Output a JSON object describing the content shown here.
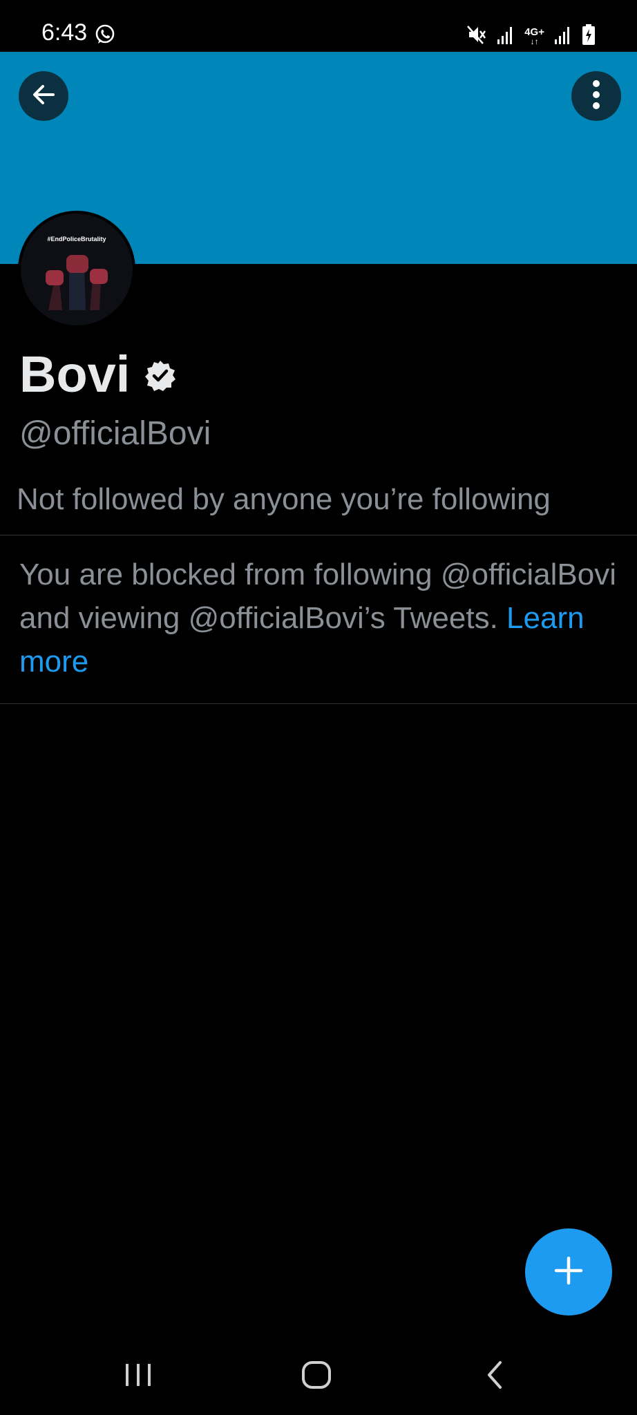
{
  "status_bar": {
    "time": "6:43",
    "network_label": "4G+",
    "icons": [
      "whatsapp-icon",
      "mute-icon",
      "signal-icon",
      "signal-icon",
      "battery-charging-icon"
    ]
  },
  "profile": {
    "name": "Bovi",
    "handle": "@officialBovi",
    "verified": true,
    "banner_color": "#0086b8",
    "avatar_text": "#EndPoliceBrutality",
    "followers_note": "Not followed by anyone you’re following"
  },
  "blocked": {
    "message": "You are blocked from following @officialBovi and viewing @officialBovi’s Tweets. ",
    "link_label": "Learn more"
  },
  "colors": {
    "accent": "#1d9bf0",
    "background": "#000000",
    "secondary_text": "#8b9096"
  },
  "fab": {
    "icon": "plus-icon"
  },
  "nav_bar": {
    "icons": [
      "recent-apps-icon",
      "home-icon",
      "back-icon"
    ]
  }
}
